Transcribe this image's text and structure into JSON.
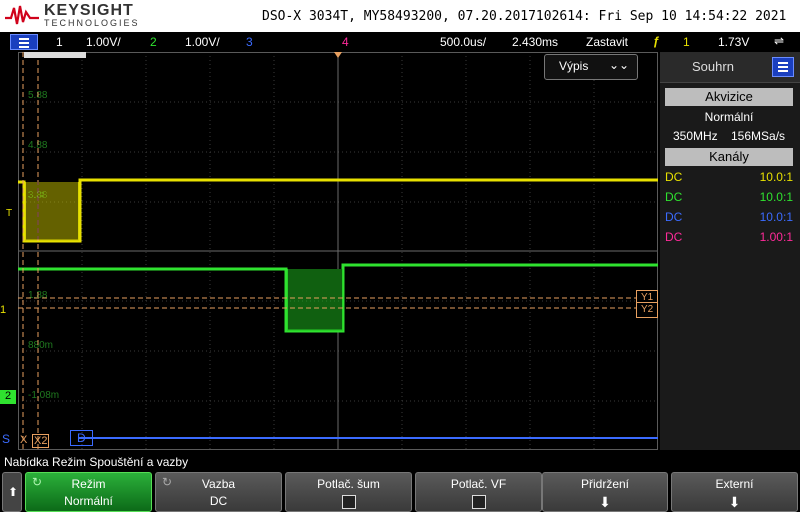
{
  "brand": {
    "name": "KEYSIGHT",
    "sub": "TECHNOLOGIES"
  },
  "instrument": {
    "title": "DSO-X 3034T, MY58493200, 07.20.2017102614: Fri Sep 10 14:54:22 2021"
  },
  "status": {
    "ch1_num": "1",
    "ch1_scale": "1.00V/",
    "ch2_num": "2",
    "ch2_scale": "1.00V/",
    "ch3_num": "3",
    "ch4_num": "4",
    "timebase": "500.0us/",
    "delay": "2.430ms",
    "run_state": "Zastavit",
    "trig_channel": "1",
    "trig_level": "1.73V",
    "trig_icon": "trigger-edge-icon"
  },
  "grid_labels": {
    "l1": "5.88",
    "l2": "4.88",
    "l3": "3.88",
    "l4": "1.88",
    "l5": "880m",
    "l6": "-1.08m"
  },
  "markers": {
    "ch1": "T",
    "ch2": "1",
    "ch3": "2",
    "s": "S",
    "d": "D",
    "x1": "X",
    "x2": "X2",
    "y1": "Y1",
    "y2": "Y2"
  },
  "vypis": {
    "label": "Výpis"
  },
  "right_panel": {
    "title": "Souhrn",
    "acq_label": "Akvizice",
    "acq_mode": "Normální",
    "bw": "350MHz",
    "rate": "156MSa/s",
    "channels_label": "Kanály",
    "channels": [
      {
        "coupling": "DC",
        "probe": "10.0:1",
        "color": "#e8e100"
      },
      {
        "coupling": "DC",
        "probe": "10.0:1",
        "color": "#2fe22f"
      },
      {
        "coupling": "DC",
        "probe": "10.0:1",
        "color": "#3b6bff"
      },
      {
        "coupling": "DC",
        "probe": "1.00:1",
        "color": "#ff2a9a"
      }
    ]
  },
  "message": "Nabídka Režim Spouštění a vazby",
  "softkeys": [
    {
      "title": "Režim",
      "value": "Normální"
    },
    {
      "title": "Vazba",
      "value": "DC"
    },
    {
      "title": "Potlač. šum",
      "value": ""
    },
    {
      "title": "Potlač. VF",
      "value": ""
    },
    {
      "title": "Přidržení",
      "value": ""
    },
    {
      "title": "Externí",
      "value": ""
    }
  ],
  "colors": {
    "ch1": "#e8e100",
    "ch2": "#2fe22f",
    "ch3": "#3b6bff",
    "ch4": "#ff2a9a",
    "marker": "#e8a060"
  }
}
